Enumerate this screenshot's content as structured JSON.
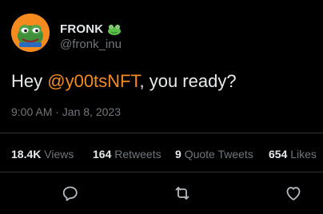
{
  "author": {
    "display_name": "FRONK",
    "handle": "@fronk_inu",
    "badge_icon": "frog-emoji-icon",
    "avatar_icon": "pepe-frog-avatar-icon"
  },
  "tweet": {
    "text_before": "Hey ",
    "mention": "@y00tsNFT",
    "text_after": ", you ready?",
    "timestamp": "9:00 AM · Jan 8, 2023"
  },
  "stats": {
    "views_count": "18.4K",
    "views_label": "Views",
    "retweets_count": "164",
    "retweets_label": "Retweets",
    "quotes_count": "9",
    "quotes_label": "Quote Tweets",
    "likes_count": "654",
    "likes_label": "Likes"
  },
  "actions": {
    "reply_icon": "reply-icon",
    "retweet_icon": "retweet-icon",
    "like_icon": "like-icon"
  },
  "colors": {
    "background": "#000000",
    "text_primary": "#e7e9ea",
    "text_secondary": "#71767b",
    "mention": "#f58a1f",
    "avatar_bg": "#f58a1f",
    "divider": "#2f3336"
  }
}
